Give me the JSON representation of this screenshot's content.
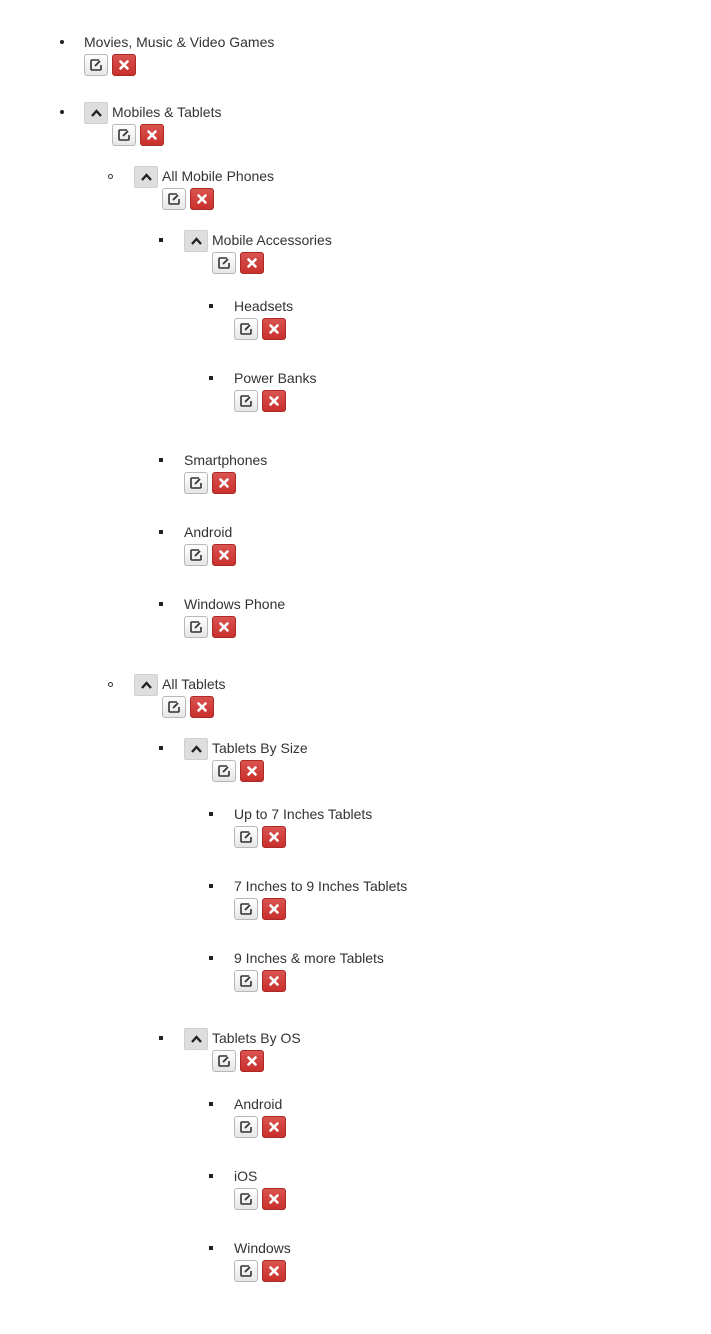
{
  "tree": {
    "nodes": [
      {
        "label": "Movies, Music & Video Games",
        "level": 1,
        "collapsible": false
      },
      {
        "label": "Mobiles & Tablets",
        "level": 1,
        "collapsible": true
      },
      {
        "label": "All Mobile Phones",
        "level": 2,
        "collapsible": true
      },
      {
        "label": "Mobile Accessories",
        "level": 3,
        "collapsible": true
      },
      {
        "label": "Headsets",
        "level": 4,
        "collapsible": false
      },
      {
        "label": "Power Banks",
        "level": 4,
        "collapsible": false
      },
      {
        "label": "Smartphones",
        "level": 3,
        "collapsible": false
      },
      {
        "label": "Android",
        "level": 3,
        "collapsible": false
      },
      {
        "label": "Windows Phone",
        "level": 3,
        "collapsible": false
      },
      {
        "label": "All Tablets",
        "level": 2,
        "collapsible": true
      },
      {
        "label": "Tablets By Size",
        "level": 3,
        "collapsible": true
      },
      {
        "label": "Up to 7 Inches Tablets",
        "level": 4,
        "collapsible": false
      },
      {
        "label": "7 Inches to 9 Inches Tablets",
        "level": 4,
        "collapsible": false
      },
      {
        "label": "9 Inches & more Tablets",
        "level": 4,
        "collapsible": false
      },
      {
        "label": "Tablets By OS",
        "level": 3,
        "collapsible": true
      },
      {
        "label": "Android",
        "level": 4,
        "collapsible": false
      },
      {
        "label": "iOS",
        "level": 4,
        "collapsible": false
      },
      {
        "label": "Windows",
        "level": 4,
        "collapsible": false
      }
    ]
  },
  "icons": {
    "collapse": "chevron-up-icon",
    "edit": "edit-icon",
    "delete": "close-icon"
  },
  "colors": {
    "delete_button": "#d9534f",
    "collapse_button": "#dedede",
    "text": "#333333"
  }
}
